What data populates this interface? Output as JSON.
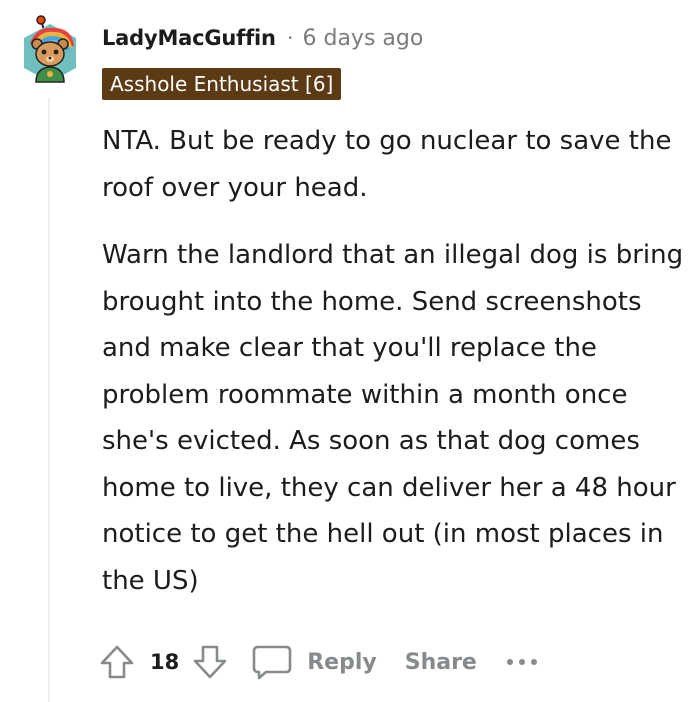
{
  "comment": {
    "username": "LadyMacGuffin",
    "separator": "·",
    "timestamp": "6 days ago",
    "flair": "Asshole Enthusiast [6]",
    "paragraphs": [
      "NTA. But be ready to go nuclear to save the roof over your head.",
      "Warn the landlord that an illegal dog is bring brought into the home. Send screenshots and make clear that you'll replace the problem roommate within a month once she's evicted. As soon as that dog comes home to live, they can deliver her a 48 hour notice to get the hell out (in most places in the US)"
    ]
  },
  "actions": {
    "upvote_icon": "upvote-arrow-icon",
    "score": "18",
    "downvote_icon": "downvote-arrow-icon",
    "reply_icon": "speech-bubble-icon",
    "reply_label": "Reply",
    "share_label": "Share",
    "more_icon": "ellipsis-icon"
  },
  "colors": {
    "flair_background": "#5c3a14",
    "muted_text": "#7c7c7c",
    "action_gray": "#878a8c",
    "thread_line": "#edeff1",
    "avatar_background": "#6fbfbf"
  }
}
